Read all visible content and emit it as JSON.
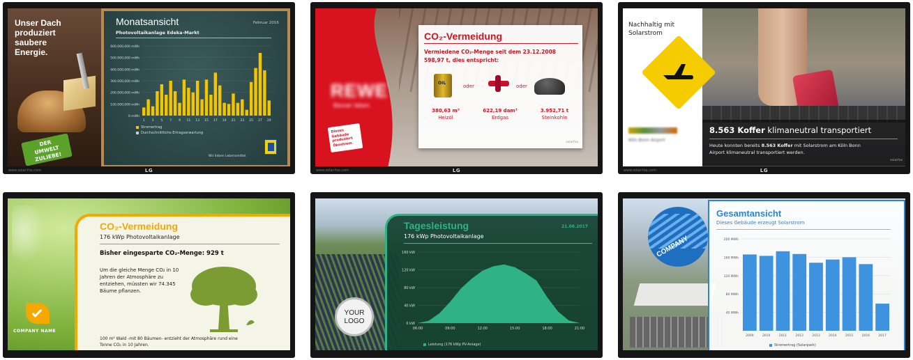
{
  "panel1": {
    "photo_text": "Unser Dach produziert saubere Energie.",
    "badge": "DER UMWELT ZULIEBE!",
    "title": "Monatsansicht",
    "date": "Februar 2016",
    "subtitle": "Photovoltaikanlage Edeka-Markt",
    "y_ticks": [
      "600.000,000 mWh",
      "500.000,000 mWh",
      "400.000,000 mWh",
      "300.000,000 mWh",
      "200.000,000 mWh",
      "100.000,000 mWh",
      "0 mWh"
    ],
    "x_ticks": [
      "1",
      "3",
      "5",
      "7",
      "9",
      "11",
      "13",
      "15",
      "17",
      "19",
      "21",
      "23",
      "25",
      "27",
      "29"
    ],
    "legend": [
      "Stromertrag",
      "Durchschnittliche Ertragserwartung"
    ],
    "footer": "Wir lieben Lebensmittel.",
    "url": "www.solar-fox.com",
    "brand": "LG",
    "colors": {
      "board": "#2e4a4a",
      "bar": "#f2c500",
      "frame": "#b58a55"
    }
  },
  "panel2": {
    "title": "CO₂-Vermeidung",
    "sub1": "Vermiedene CO₂-Menge seit dem 23.12.2008",
    "sub2": "598,97 t, dies entspricht:",
    "or1": "oder",
    "or2": "oder",
    "oil_label": "OIL",
    "items": [
      {
        "value": "380,63 m³",
        "label": "Heizöl"
      },
      {
        "value": "622,19 dam³",
        "label": "Erdgas"
      },
      {
        "value": "3.952,71 t",
        "label": "Steinkohle"
      }
    ],
    "logo": "REWE",
    "logo_sub": "Besser leben.",
    "sticker": "Dieses Gebäude produziert Ökostrom.",
    "credit": "solarfox",
    "url": "www.solar-fox.com",
    "brand": "LG",
    "colors": {
      "accent": "#d9121f"
    }
  },
  "panel3": {
    "title": "Nachhaltig mit Solarstrom",
    "headline_bold": "8.563 Koffer",
    "headline_rest": " klimaneutral transportiert",
    "body_pre": "Heute konnten bereits ",
    "body_bold": "8.563 Koffer",
    "body_post": " mit Solarstrom am Köln Bonn Airport klimaneutral transportiert werden.",
    "logo_text": "Köln Bonn Airport",
    "credit": "solarfox",
    "url": "www.solar-fox.com",
    "brand": "LG",
    "colors": {
      "plane": "#f5cc00"
    }
  },
  "panel4": {
    "title": "CO₂-Vermeidung",
    "subtitle": "176 kWp Photovoltaikanlage",
    "total": "Bisher eingesparte CO₂-Menge: 929 t",
    "body": "Um die gleiche Menge CO₂ in 10 Jahren der Atmosphäre zu entziehen, müssten wir 74.345 Bäume pflanzen.",
    "footer": "100 m² Wald -mit 80 Bäumen- entzieht der Atmosphäre rund eine Tonne CO₂ in 10 Jahren.",
    "company": "COMPANY NAME",
    "colors": {
      "accent": "#f4a800",
      "tree": "#7a9c33"
    }
  },
  "panel5": {
    "title": "Tagesleistung",
    "date": "21.06.2017",
    "subtitle": "176 kWp Photovoltaikanlage",
    "logo_line1": "YOUR",
    "logo_line2": "LOGO",
    "y_ticks": [
      "160 kW",
      "120 kW",
      "80 kW",
      "40 kW",
      "0 kW"
    ],
    "x_ticks": [
      "06:00",
      "09:00",
      "12:00",
      "15:00",
      "18:00",
      "21:00"
    ],
    "legend": "Leistung (176 kWp PV-Anlage)",
    "colors": {
      "panel": "#164536",
      "fill": "#2fb386"
    }
  },
  "panel6": {
    "logo": "COMPANY",
    "title": "Gesamtansicht",
    "subtitle": "Dieses Gebäude erzeugt Solarstrom",
    "y_ticks": [
      "200 MWh",
      "160 MWh",
      "120 MWh",
      "80 MWh",
      "40 MWh"
    ],
    "legend": "Stromertrag (Solarpark)",
    "colors": {
      "accent": "#2b83d8",
      "bar": "#3e93e0"
    }
  },
  "chart_data": [
    {
      "type": "bar",
      "title": "Monatsansicht",
      "subtitle": "Photovoltaikanlage Edeka-Markt",
      "categories": [
        "1",
        "2",
        "3",
        "4",
        "5",
        "6",
        "7",
        "8",
        "9",
        "10",
        "11",
        "12",
        "13",
        "14",
        "15",
        "16",
        "17",
        "18",
        "19",
        "20",
        "21",
        "22",
        "23",
        "24",
        "25",
        "26",
        "27",
        "28",
        "29"
      ],
      "series": [
        {
          "name": "Stromertrag",
          "values": [
            70000,
            140000,
            80000,
            210000,
            270000,
            180000,
            300000,
            210000,
            110000,
            310000,
            240000,
            200000,
            300000,
            140000,
            310000,
            180000,
            370000,
            260000,
            110000,
            100000,
            190000,
            110000,
            140000,
            50000,
            290000,
            410000,
            540000,
            390000,
            130000
          ]
        }
      ],
      "ylim": [
        0,
        600000
      ]
    },
    {
      "type": "area",
      "title": "Tagesleistung",
      "x": [
        "06:00",
        "07:00",
        "08:00",
        "09:00",
        "10:00",
        "11:00",
        "12:00",
        "13:00",
        "14:00",
        "15:00",
        "16:00",
        "17:00",
        "18:00",
        "19:00",
        "20:00",
        "21:00"
      ],
      "series": [
        {
          "name": "Leistung (176 kWp PV-Anlage)",
          "values": [
            0,
            5,
            22,
            48,
            78,
            100,
            118,
            128,
            132,
            126,
            112,
            96,
            58,
            26,
            6,
            0
          ]
        }
      ],
      "ylim": [
        0,
        160
      ]
    },
    {
      "type": "bar",
      "title": "Gesamtansicht",
      "categories": [
        "2009",
        "2010",
        "2011",
        "2012",
        "2013",
        "2014",
        "2015",
        "2016",
        "2017"
      ],
      "series": [
        {
          "name": "Stromertrag (Solarpark)",
          "values": [
            166,
            163,
            173,
            167,
            148,
            155,
            160,
            145,
            59
          ]
        }
      ],
      "ylim": [
        0,
        200
      ]
    }
  ]
}
